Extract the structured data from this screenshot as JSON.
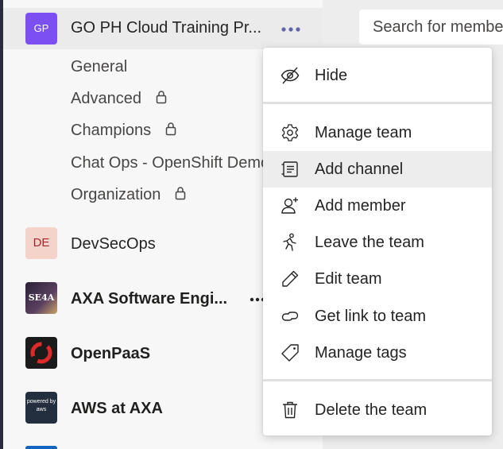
{
  "search": {
    "placeholder": "Search for members"
  },
  "active_team": {
    "initials": "GP",
    "name": "GO PH Cloud Training Pr...",
    "avatar_color": "#7b4ff2",
    "more_icon": "more-options-icon",
    "channels": [
      {
        "label": "General",
        "private": false
      },
      {
        "label": "Advanced",
        "private": true
      },
      {
        "label": "Champions",
        "private": true
      },
      {
        "label": "Chat Ops - OpenShift Demo",
        "private": false
      },
      {
        "label": "Organization",
        "private": true
      }
    ]
  },
  "teams": [
    {
      "initials": "DE",
      "name": "DevSecOps",
      "bold": false,
      "avatar_color": "#f4d3cb",
      "initials_color": "#a4262c"
    },
    {
      "initials": "SE4A",
      "name": "AXA Software Engi...",
      "bold": true,
      "avatar_color": "#3a2f4a"
    },
    {
      "initials": "",
      "name": "OpenPaaS",
      "bold": true,
      "avatar_color": "#1b1b1b"
    },
    {
      "initials": "powered by aws",
      "name": "AWS at AXA",
      "bold": true,
      "avatar_color": "#232f3e"
    }
  ],
  "context_menu": {
    "items": [
      {
        "label": "Hide",
        "icon": "hide-icon"
      },
      {
        "label": "Manage team",
        "icon": "gear-icon"
      },
      {
        "label": "Add channel",
        "icon": "add-channel-icon",
        "highlighted": true
      },
      {
        "label": "Add member",
        "icon": "add-member-icon"
      },
      {
        "label": "Leave the team",
        "icon": "leave-icon"
      },
      {
        "label": "Edit team",
        "icon": "pencil-icon"
      },
      {
        "label": "Get link to team",
        "icon": "link-icon"
      },
      {
        "label": "Manage tags",
        "icon": "tag-icon"
      },
      {
        "label": "Delete the team",
        "icon": "trash-icon"
      }
    ]
  },
  "colors": {
    "accent": "#6264a7",
    "menu_highlight": "#ededed"
  }
}
